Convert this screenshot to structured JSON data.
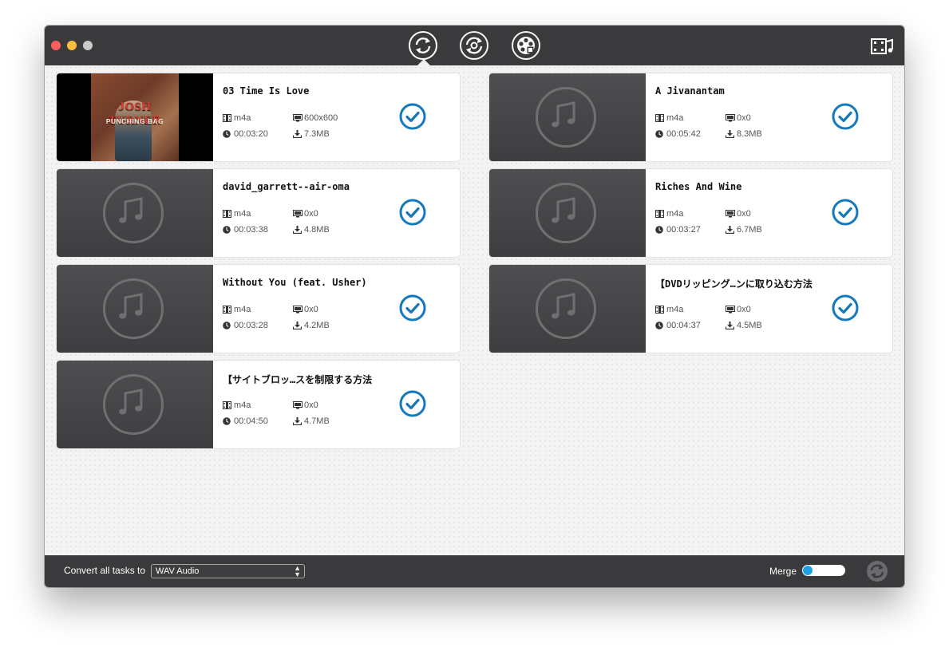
{
  "window": {
    "toolbar": {
      "tools": [
        {
          "icon": "convert-icon",
          "active": true
        },
        {
          "icon": "sync-icon",
          "active": false
        },
        {
          "icon": "dvd-icon",
          "active": false
        }
      ],
      "right_icon": "media-library-icon"
    }
  },
  "tasks": [
    {
      "title": "03 Time Is Love",
      "format": "m4a",
      "resolution": "600x600",
      "duration": "00:03:20",
      "size": "7.3MB",
      "checked": true,
      "thumbnail": "album-art",
      "album_art": {
        "artist": "JOSH TURNER",
        "album": "PUNCHING BAG"
      }
    },
    {
      "title": "A Jivanantam",
      "format": "m4a",
      "resolution": "0x0",
      "duration": "00:05:42",
      "size": "8.3MB",
      "checked": true,
      "thumbnail": "music-note-icon"
    },
    {
      "title": "david_garrett--air-oma",
      "format": "m4a",
      "resolution": "0x0",
      "duration": "00:03:38",
      "size": "4.8MB",
      "checked": true,
      "thumbnail": "music-note-icon"
    },
    {
      "title": "Riches And Wine",
      "format": "m4a",
      "resolution": "0x0",
      "duration": "00:03:27",
      "size": "6.7MB",
      "checked": true,
      "thumbnail": "music-note-icon"
    },
    {
      "title": "Without You (feat. Usher)",
      "format": "m4a",
      "resolution": "0x0",
      "duration": "00:03:28",
      "size": "4.2MB",
      "checked": true,
      "thumbnail": "music-note-icon"
    },
    {
      "title": "【DVDリッピング…ンに取り込む方法",
      "format": "m4a",
      "resolution": "0x0",
      "duration": "00:04:37",
      "size": "4.5MB",
      "checked": true,
      "thumbnail": "music-note-icon"
    },
    {
      "title": "【サイトブロッ…スを制限する方法",
      "format": "m4a",
      "resolution": "0x0",
      "duration": "00:04:50",
      "size": "4.7MB",
      "checked": true,
      "thumbnail": "music-note-icon"
    }
  ],
  "footer": {
    "convert_label": "Convert all tasks to",
    "output_format": "WAV Audio",
    "merge_label": "Merge",
    "merge_enabled": false,
    "accent_color": "#1da0e4",
    "check_color": "#1478bd"
  }
}
